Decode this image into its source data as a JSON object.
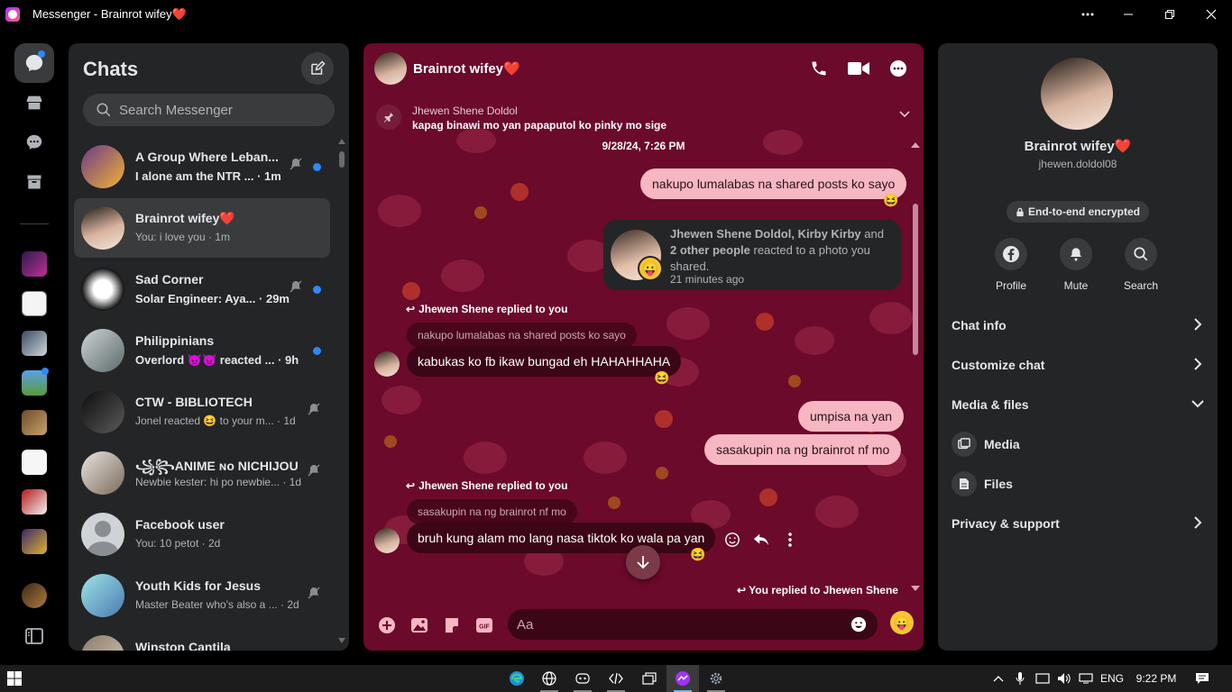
{
  "window": {
    "title": "Messenger - Brainrot wifey❤️",
    "more_icon": "more-horizontal-icon",
    "minimize_icon": "minimize-icon",
    "restore_icon": "restore-icon",
    "close_icon": "close-icon"
  },
  "rail": {
    "items": [
      {
        "name": "chats",
        "icon": "chat-bubble-icon",
        "active": true,
        "badge": true
      },
      {
        "name": "marketplace",
        "icon": "store-icon"
      },
      {
        "name": "requests",
        "icon": "message-requests-icon"
      },
      {
        "name": "archive",
        "icon": "archive-icon"
      }
    ],
    "toggle_icon": "sidebar-toggle-icon"
  },
  "chat_list": {
    "title": "Chats",
    "compose_icon": "compose-icon",
    "search_placeholder": "Search Messenger",
    "items": [
      {
        "name": "A Group Where Leban...",
        "preview": "I alone am the NTR ... · 1m",
        "unread": true,
        "muted": true,
        "dot": true
      },
      {
        "name": "Brainrot wifey❤️",
        "preview": "You: i love you · 1m",
        "unread": false,
        "muted": false,
        "dot": false,
        "selected": true
      },
      {
        "name": "Sad Corner",
        "preview": "Solar Engineer: Aya... · 29m",
        "unread": true,
        "muted": true,
        "dot": true
      },
      {
        "name": "Philippinians",
        "preview": "Overlord 👿👿 reacted ... · 9h",
        "unread": true,
        "muted": false,
        "dot": true
      },
      {
        "name": "CTW - BIBLIOTECH",
        "preview": "Jonel reacted 😆 to your m... · 1d",
        "unread": false,
        "muted": true,
        "dot": false
      },
      {
        "name": "꧁꧂ANIME ɴᴏ NICHIJOU...",
        "preview": "Newbie kester: hi po newbie... · 1d",
        "unread": false,
        "muted": true,
        "dot": false
      },
      {
        "name": "Facebook user",
        "preview": "You: 10 petot · 2d",
        "unread": false,
        "muted": false,
        "dot": false
      },
      {
        "name": "Youth Kids for Jesus",
        "preview": "Master Beater who's also a ... · 2d",
        "unread": false,
        "muted": true,
        "dot": false
      },
      {
        "name": "Winston Cantila",
        "preview": "",
        "unread": false,
        "muted": false,
        "dot": false
      }
    ]
  },
  "conversation": {
    "name": "Brainrot wifey❤️",
    "call_icon": "phone-icon",
    "video_icon": "video-camera-icon",
    "more_icon": "more-options-icon",
    "pinned": {
      "sender": "Jhewen Shene Doldol",
      "text": "kapag binawi mo yan papaputol ko pinky mo sige"
    },
    "timestamp": "9/28/24, 7:26 PM",
    "msg_shared_posts": "nakupo lumalabas na shared posts ko sayo",
    "share_card": {
      "bold1": "Jhewen Shene Doldol, Kirby Kirby",
      "mid": "and",
      "bold2": "2 other people",
      "rest": "reacted to a photo you shared.",
      "time": "21 minutes ago"
    },
    "reply1_header": "Jhewen Shene replied to you",
    "reply1_context": "nakupo lumalabas na shared posts ko sayo",
    "reply1_text": "kabukas ko fb ikaw bungad eh HAHAHHAHA",
    "out2": "umpisa na yan",
    "out3": "sasakupin na ng brainrot nf mo",
    "reply2_header": "Jhewen Shene replied to you",
    "reply2_context": "sasakupin na ng brainrot nf mo",
    "reply2_text": "bruh kung alam mo lang nasa tiktok ko wala pa yan",
    "footer": "You replied to Jhewen Shene",
    "reaction_emoji": "😆",
    "composer_placeholder": "Aa",
    "like_emoji": "😛"
  },
  "info_panel": {
    "name": "Brainrot wifey❤️",
    "username": "jhewen.doldol08",
    "e2e": "End-to-end encrypted",
    "actions": [
      {
        "label": "Profile",
        "icon": "facebook-icon"
      },
      {
        "label": "Mute",
        "icon": "bell-icon"
      },
      {
        "label": "Search",
        "icon": "search-icon"
      }
    ],
    "rows": {
      "chat_info": "Chat info",
      "customize": "Customize chat",
      "media_files": "Media & files",
      "media": "Media",
      "files": "Files",
      "privacy": "Privacy & support"
    }
  },
  "taskbar": {
    "lang": "ENG",
    "time": "9:22 PM"
  },
  "colors": {
    "accent": "#6b0a2b",
    "outgoing_bubble": "#f7b7c2",
    "incoming_bubble": "#3b0615",
    "panel": "#242526",
    "unread_dot": "#2d88ff"
  }
}
